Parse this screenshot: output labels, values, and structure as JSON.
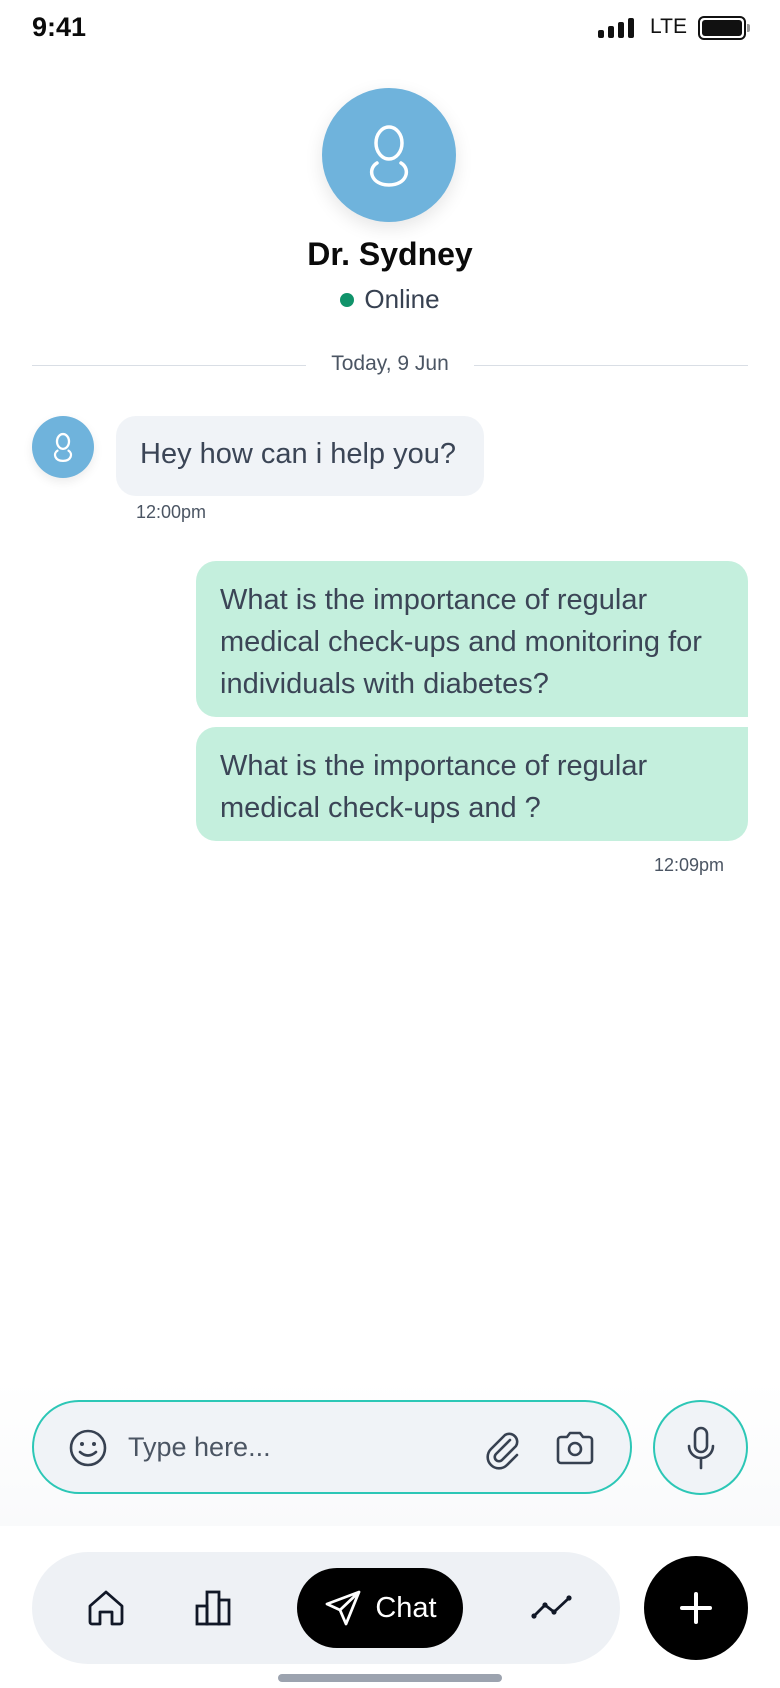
{
  "status_bar": {
    "time": "9:41",
    "network": "LTE"
  },
  "header": {
    "doctor_name": "Dr. Sydney",
    "status": "Online",
    "status_color": "#10936a",
    "avatar_color": "#6fb3dc"
  },
  "chat": {
    "date_separator": "Today, 9 Jun",
    "messages": [
      {
        "direction": "incoming",
        "text": "Hey how can i help you?",
        "time": "12:00pm"
      },
      {
        "direction": "outgoing",
        "text": "What is the importance of regular medical check-ups and monitoring for individuals with diabetes?"
      },
      {
        "direction": "outgoing",
        "text": "What is the importance of regular medical check-ups and ?",
        "time": "12:09pm"
      }
    ]
  },
  "composer": {
    "placeholder": "Type here...",
    "icons": [
      "smile-icon",
      "paperclip-icon",
      "camera-icon",
      "microphone-icon"
    ],
    "accent_color": "#2cc7b6"
  },
  "bottom_nav": {
    "items": [
      {
        "icon": "home-icon"
      },
      {
        "icon": "bar-chart-icon"
      },
      {
        "icon": "send-icon",
        "label": "Chat",
        "active": true
      },
      {
        "icon": "trend-line-icon"
      }
    ],
    "fab_icon": "plus-icon"
  }
}
